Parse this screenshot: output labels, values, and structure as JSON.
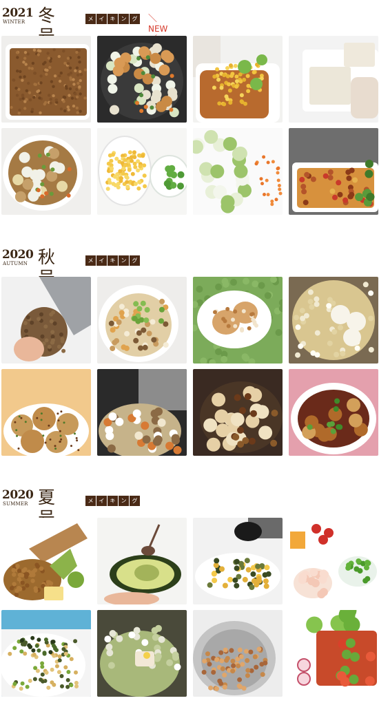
{
  "sections": [
    {
      "year": "2021",
      "season_en": "WINTER",
      "season_jp": "冬号",
      "badge": [
        "メ",
        "イ",
        "キ",
        "ン",
        "グ"
      ],
      "new_label": "NEW",
      "tiles": [
        {
          "name": "ground-meat-tray",
          "theme": "meat"
        },
        {
          "name": "stirfry-pan",
          "theme": "pan"
        },
        {
          "name": "tofu-pouch-egg",
          "theme": "pouch"
        },
        {
          "name": "tofu-block",
          "theme": "tofu"
        },
        {
          "name": "tofu-bowl",
          "theme": "bowl"
        },
        {
          "name": "egg-and-beans",
          "theme": "egg"
        },
        {
          "name": "cut-vegetables",
          "theme": "veg"
        },
        {
          "name": "baked-dish",
          "theme": "baked"
        }
      ]
    },
    {
      "year": "2020",
      "season_en": "AUTUMN",
      "season_jp": "秋号",
      "badge": [
        "メ",
        "イ",
        "キ",
        "ン",
        "グ"
      ],
      "new_label": "",
      "tiles": [
        {
          "name": "peeling-taro",
          "theme": "taro"
        },
        {
          "name": "mixed-rice-bowl",
          "theme": "rice"
        },
        {
          "name": "pan-fried-cakes",
          "theme": "cakes"
        },
        {
          "name": "deep-frying",
          "theme": "fry"
        },
        {
          "name": "taro-balls",
          "theme": "balls"
        },
        {
          "name": "rice-cooker",
          "theme": "cooker"
        },
        {
          "name": "simmered-taro",
          "theme": "simmer"
        },
        {
          "name": "glazed-dish",
          "theme": "glazed"
        }
      ]
    },
    {
      "year": "2020",
      "season_en": "SUMMER",
      "season_jp": "夏号",
      "badge": [
        "メ",
        "イ",
        "キ",
        "ン",
        "グ"
      ],
      "new_label": "",
      "tiles": [
        {
          "name": "natto-avocado",
          "theme": "natto"
        },
        {
          "name": "avocado-spoon",
          "theme": "avocado"
        },
        {
          "name": "salad-plate",
          "theme": "salad"
        },
        {
          "name": "ingredients-bowls",
          "theme": "ingredients"
        },
        {
          "name": "pasta-plate",
          "theme": "pasta"
        },
        {
          "name": "broth-pot",
          "theme": "broth"
        },
        {
          "name": "colander-bonito",
          "theme": "colander"
        },
        {
          "name": "jelly-okra",
          "theme": "jelly"
        }
      ]
    }
  ]
}
